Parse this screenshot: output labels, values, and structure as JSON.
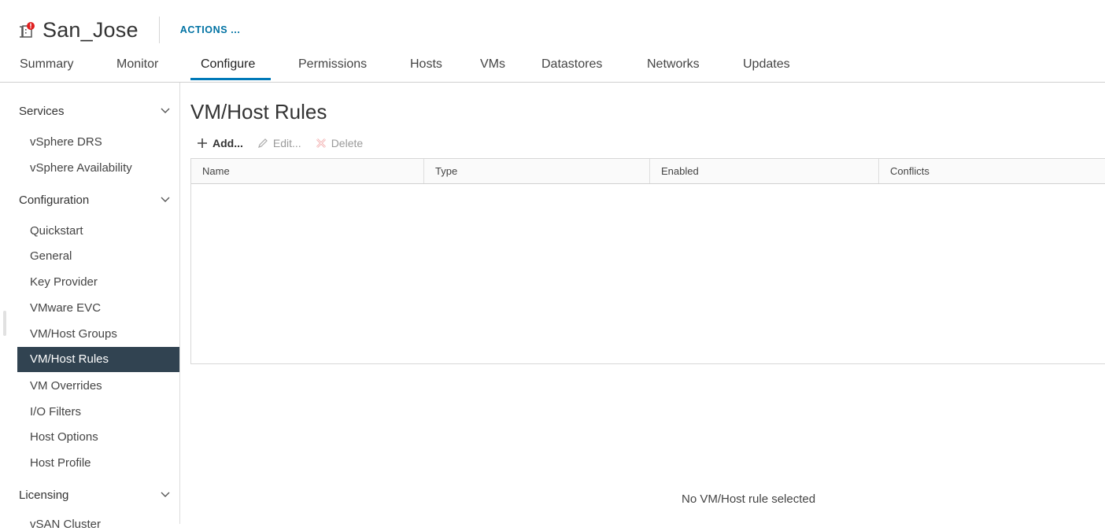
{
  "header": {
    "object_title": "San_Jose",
    "actions_label": "ACTIONS ...",
    "icon": "cluster-icon-with-alert"
  },
  "tabs": [
    {
      "label": "Summary"
    },
    {
      "label": "Monitor"
    },
    {
      "label": "Configure",
      "active": true
    },
    {
      "label": "Permissions"
    },
    {
      "label": "Hosts"
    },
    {
      "label": "VMs"
    },
    {
      "label": "Datastores"
    },
    {
      "label": "Networks"
    },
    {
      "label": "Updates"
    }
  ],
  "sidebar": {
    "sections": [
      {
        "label": "Services",
        "items": [
          "vSphere DRS",
          "vSphere Availability"
        ]
      },
      {
        "label": "Configuration",
        "items": [
          "Quickstart",
          "General",
          "Key Provider",
          "VMware EVC",
          "VM/Host Groups",
          "VM/Host Rules",
          "VM Overrides",
          "I/O Filters",
          "Host Options",
          "Host Profile"
        ]
      },
      {
        "label": "Licensing",
        "items": [
          "vSAN Cluster"
        ]
      }
    ],
    "selected": "VM/Host Rules"
  },
  "main": {
    "title": "VM/Host Rules",
    "toolbar": {
      "add_label": "Add...",
      "edit_label": "Edit...",
      "delete_label": "Delete"
    },
    "columns": [
      "Name",
      "Type",
      "Enabled",
      "Conflicts"
    ],
    "empty_detail": "No VM/Host rule selected"
  },
  "colors": {
    "accent": "#0079b8",
    "actions_text": "#0072a3",
    "selected_bg": "#314351",
    "alert": "#e02020"
  }
}
